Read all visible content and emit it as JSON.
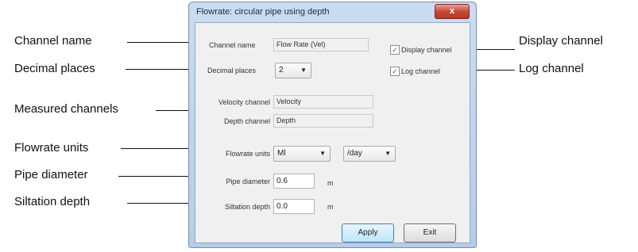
{
  "annotations": {
    "channel_name": "Channel name",
    "decimal_places": "Decimal places",
    "measured_channels": "Measured channels",
    "flowrate_units": "Flowrate units",
    "pipe_diameter": "Pipe diameter",
    "siltation_depth": "Siltation depth",
    "display_channel": "Display channel",
    "log_channel": "Log channel"
  },
  "dialog": {
    "title": "Flowrate: circular pipe using depth",
    "close_glyph": "x",
    "channel_name_label": "Channel name",
    "channel_name_value": "Flow Rate (Vel)",
    "decimal_places_label": "Decimal places",
    "decimal_places_value": "2",
    "display_channel_label": "Display channel",
    "display_channel_checked": true,
    "log_channel_label": "Log channel",
    "log_channel_checked": true,
    "velocity_channel_label": "Velocity channel",
    "velocity_channel_value": "Velocity",
    "depth_channel_label": "Depth channel",
    "depth_channel_value": "Depth",
    "flowrate_units_label": "Flowrate units",
    "flowrate_unit_value": "Ml",
    "flowrate_time_value": "/day",
    "pipe_diameter_label": "Pipe diameter",
    "pipe_diameter_value": "0.6",
    "pipe_diameter_unit": "m",
    "siltation_depth_label": "Siltation depth",
    "siltation_depth_value": "0.0",
    "siltation_depth_unit": "m",
    "apply_label": "Apply",
    "exit_label": "Exit"
  }
}
